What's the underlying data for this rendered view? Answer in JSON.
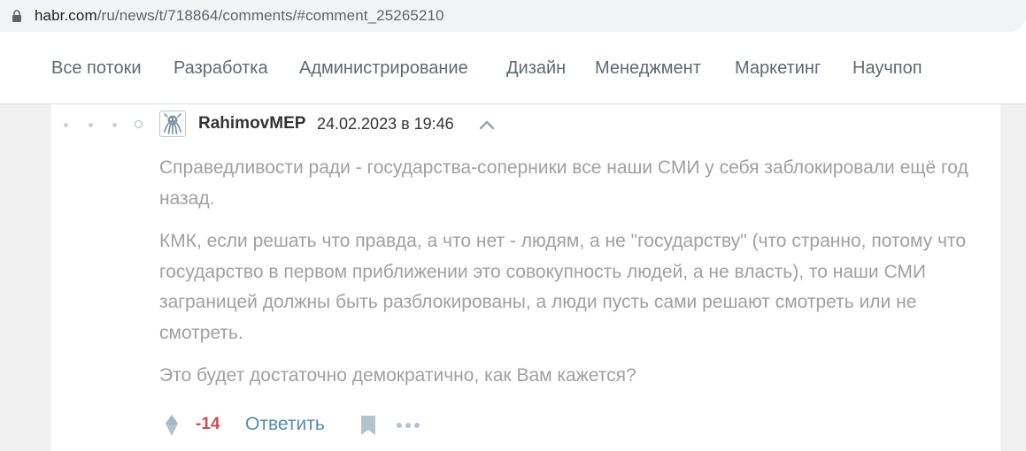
{
  "browser": {
    "url_host": "habr.com",
    "url_path": "/ru/news/t/718864/comments/#comment_25265210",
    "lock_icon": "lock-icon"
  },
  "nav": {
    "items": [
      "Все потоки",
      "Разработка",
      "Администрирование",
      "Дизайн",
      "Менеджмент",
      "Маркетинг",
      "Научпоп"
    ]
  },
  "comment": {
    "username": "RahimovMEP",
    "timestamp": "24.02.2023 в 19:46",
    "paragraphs": [
      "Справедливости ради - государства-соперники все наши СМИ у себя заблокировали ещё год назад.",
      "КМК, если решать что правда, а что нет - людям, а не \"государству\" (что странно, потому что государство в первом приближении это совокупность людей, а не власть), то наши СМИ заграницей должны быть разблокированы, а люди пусть сами решают смотреть или не смотреть.",
      "Это будет достаточно демократично, как Вам кажется?"
    ],
    "score": "-14",
    "reply_label": "Ответить",
    "icons": {
      "avatar": "octopus-avatar-icon",
      "collapse": "chevron-up-icon",
      "vote": "vote-diamond-icon",
      "bookmark": "bookmark-icon",
      "more": "more-dots-icon"
    }
  },
  "colors": {
    "score_negative": "#d04e4e",
    "link": "#548eaa",
    "comment_text": "#a0a0a0",
    "nav_text": "#5e6973"
  }
}
